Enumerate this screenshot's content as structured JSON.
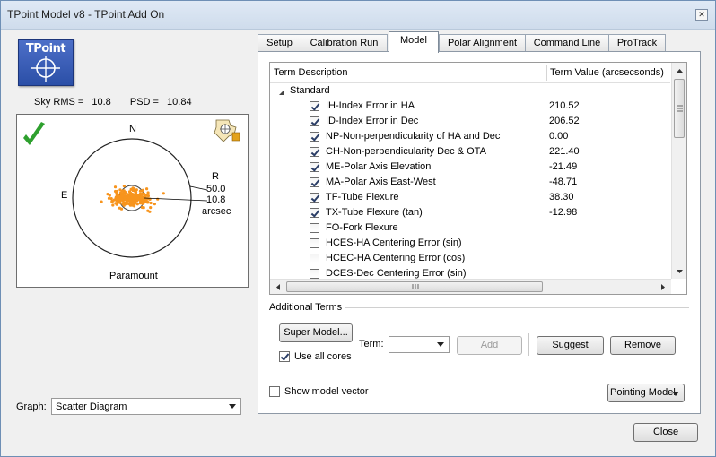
{
  "window": {
    "title": "TPoint Model v8 - TPoint Add On",
    "close_symbol": "✕"
  },
  "logo": {
    "text": "TPoint"
  },
  "stats": {
    "sky_rms_label": "Sky RMS =",
    "sky_rms_value": "10.8",
    "psd_label": "PSD =",
    "psd_value": "10.84"
  },
  "plot": {
    "north": "N",
    "east": "E",
    "r_label": "R",
    "r_outer": "50.0",
    "r_inner": "10.8",
    "units": "arcsec",
    "mount_name": "Paramount",
    "status_color": "#2ea02e",
    "point_color": "#f7941d"
  },
  "graph": {
    "label": "Graph:",
    "selected": "Scatter Diagram"
  },
  "tabs": [
    {
      "label": "Setup"
    },
    {
      "label": "Calibration Run"
    },
    {
      "label": "Model"
    },
    {
      "label": "Polar Alignment"
    },
    {
      "label": "Command Line"
    },
    {
      "label": "ProTrack"
    }
  ],
  "model": {
    "col_desc": "Term Description",
    "col_value": "Term Value (arcsecsonds)",
    "group": "Standard",
    "terms": [
      {
        "label": "IH-Index Error in HA",
        "value": "210.52",
        "checked": true
      },
      {
        "label": "ID-Index Error in Dec",
        "value": "206.52",
        "checked": true
      },
      {
        "label": "NP-Non-perpendicularity of HA and Dec",
        "value": "0.00",
        "checked": true
      },
      {
        "label": "CH-Non-perpendicularity Dec & OTA",
        "value": "221.40",
        "checked": true
      },
      {
        "label": "ME-Polar Axis Elevation",
        "value": "-21.49",
        "checked": true
      },
      {
        "label": "MA-Polar Axis East-West",
        "value": "-48.71",
        "checked": true
      },
      {
        "label": "TF-Tube Flexure",
        "value": "38.30",
        "checked": true
      },
      {
        "label": "TX-Tube Flexure (tan)",
        "value": "-12.98",
        "checked": true
      },
      {
        "label": "FO-Fork Flexure",
        "value": "",
        "checked": false
      },
      {
        "label": "HCES-HA Centering Error (sin)",
        "value": "",
        "checked": false
      },
      {
        "label": "HCEC-HA Centering Error (cos)",
        "value": "",
        "checked": false
      },
      {
        "label": "DCES-Dec Centering Error (sin)",
        "value": "",
        "checked": false
      }
    ],
    "additional_terms_label": "Additional Terms",
    "super_model_label": "Super Model...",
    "term_label": "Term:",
    "term_value": "",
    "add_label": "Add",
    "suggest_label": "Suggest",
    "remove_label": "Remove",
    "use_all_cores_label": "Use all cores",
    "show_model_vector_label": "Show model vector",
    "pointing_model_label": "Pointing Model"
  },
  "footer": {
    "close_label": "Close"
  }
}
